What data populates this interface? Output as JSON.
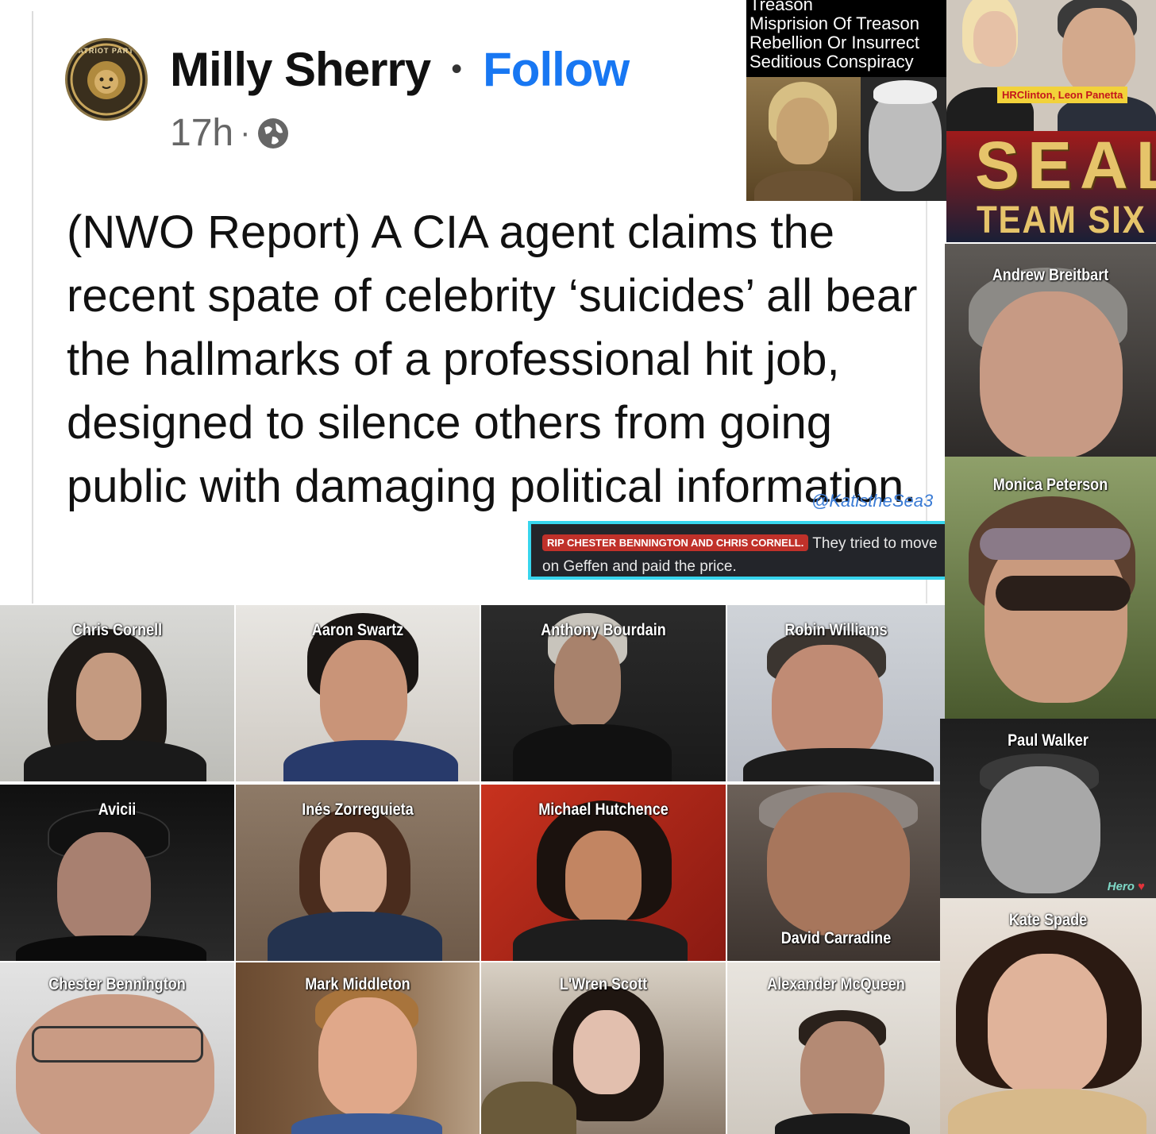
{
  "post": {
    "author": "Milly Sherry",
    "separator": "•",
    "follow_label": "Follow",
    "time": "17h",
    "dot": "·",
    "avatar_text": "PATRIOT PARTY",
    "body": "(NWO Report) A CIA agent claims the recent spate of celebrity ‘suicides’ all bear the hallmarks of a professional hit job, designed to silence others from going public with damaging political information.",
    "watermark": "@KatistheSea3"
  },
  "rip_banner": {
    "tag": "RIP CHESTER BENNINGTON AND CHRIS CORNELL.",
    "text_line1": "They tried to move",
    "text_line2": "on Geffen and paid the price."
  },
  "treason_box": {
    "lines": [
      "Treason",
      "Misprision Of Treason",
      "Rebellion Or Insurrect",
      "Seditious Conspiracy"
    ]
  },
  "seal_panel": {
    "tag": "HRClinton, Leon Panetta",
    "big": "SEAL",
    "sub": "TEAM SIX"
  },
  "grid": [
    {
      "name": "Chris Cornell"
    },
    {
      "name": "Aaron Swartz"
    },
    {
      "name": "Anthony Bourdain"
    },
    {
      "name": "Robin Williams"
    },
    {
      "name": "Avicii"
    },
    {
      "name": "Inés Zorreguieta"
    },
    {
      "name": "Michael Hutchence"
    },
    {
      "name": "David Carradine"
    },
    {
      "name": "Chester Bennington"
    },
    {
      "name": "Mark Middleton"
    },
    {
      "name": "L'Wren Scott"
    },
    {
      "name": "Alexander McQueen"
    }
  ],
  "side": [
    {
      "name": "Andrew Breitbart"
    },
    {
      "name": "Monica Peterson"
    },
    {
      "name": "Paul Walker",
      "extra": "Hero"
    },
    {
      "name": "Kate Spade"
    }
  ],
  "colors": {
    "follow_blue": "#1877f2",
    "rip_red": "#c0312a",
    "banner_border": "#38d6ee",
    "seal_gold": "#e6c46a"
  }
}
